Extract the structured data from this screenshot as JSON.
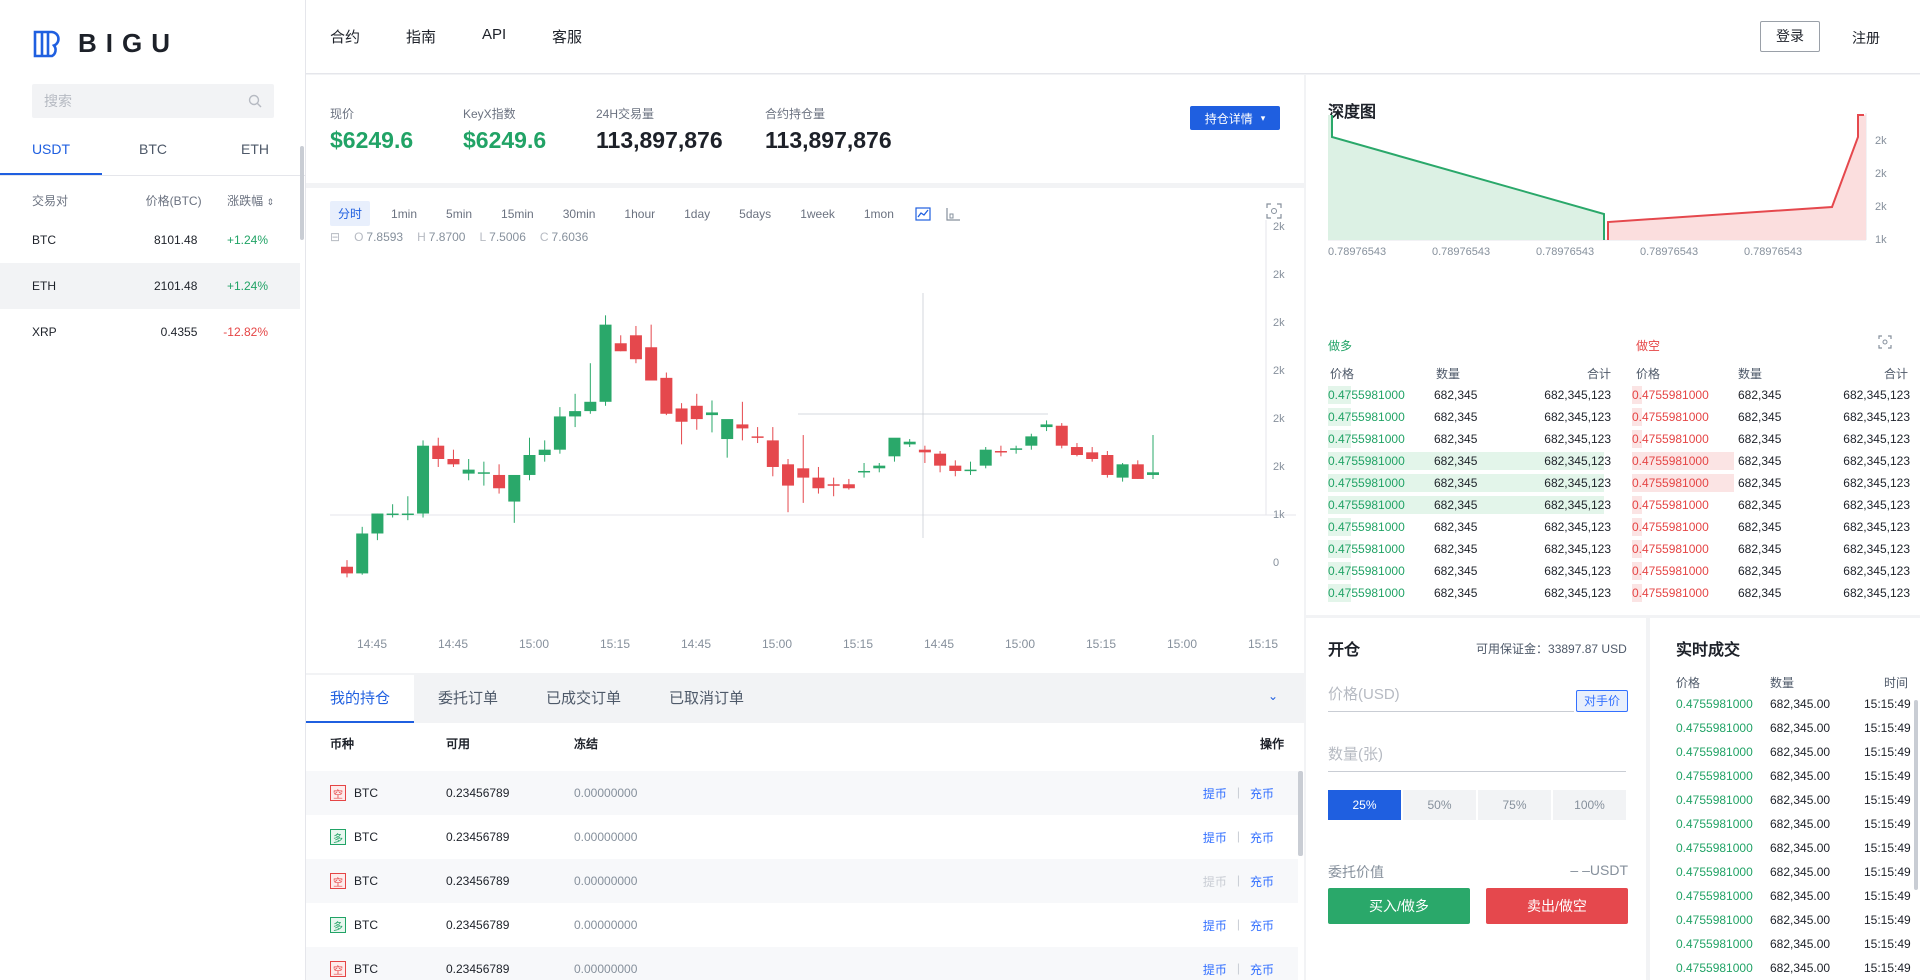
{
  "brand": {
    "name": "BIGU"
  },
  "sidebar": {
    "search_placeholder": "搜索",
    "tabs": [
      "USDT",
      "BTC",
      "ETH"
    ],
    "headers": {
      "pair": "交易对",
      "price": "价格(BTC)",
      "change": "涨跌幅"
    },
    "pairs": [
      {
        "name": "BTC",
        "price": "8101.48",
        "change": "+1.24%"
      },
      {
        "name": "ETH",
        "price": "2101.48",
        "change": "+1.24%"
      },
      {
        "name": "XRP",
        "price": "0.4355",
        "change": "-12.82%"
      }
    ]
  },
  "nav": {
    "items": [
      "合约",
      "指南",
      "API",
      "客服"
    ],
    "login": "登录",
    "register": "注册"
  },
  "stats": {
    "current": {
      "label": "现价",
      "value": "$6249.6"
    },
    "index": {
      "label": "KeyX指数",
      "value": "$6249.6"
    },
    "volume": {
      "label": "24H交易量",
      "value": "113,897,876"
    },
    "open_interest": {
      "label": "合约持仓量",
      "value": "113,897,876"
    },
    "detail_button": "持仓详情"
  },
  "chart": {
    "timeframes": [
      "分时",
      "1min",
      "5min",
      "15min",
      "30min",
      "1hour",
      "1day",
      "5days",
      "1week",
      "1mon"
    ],
    "ohlc": {
      "O": "7.8593",
      "H": "7.8700",
      "L": "7.5006",
      "C": "7.6036"
    },
    "y_ticks": [
      "2k",
      "2k",
      "2k",
      "2k",
      "2k",
      "2k",
      "1k",
      "0"
    ],
    "x_ticks": [
      "14:45",
      "14:45",
      "15:00",
      "15:15",
      "14:45",
      "15:00",
      "15:15",
      "14:45",
      "15:00",
      "15:15",
      "15:00",
      "15:15"
    ]
  },
  "chart_data": {
    "type": "candlestick",
    "candles": [
      {
        "o": 1.05,
        "h": 1.1,
        "l": 0.97,
        "c": 1.0
      },
      {
        "o": 1.0,
        "h": 1.35,
        "l": 0.99,
        "c": 1.3
      },
      {
        "o": 1.3,
        "h": 1.45,
        "l": 1.25,
        "c": 1.45
      },
      {
        "o": 1.45,
        "h": 1.52,
        "l": 1.42,
        "c": 1.45
      },
      {
        "o": 1.45,
        "h": 1.58,
        "l": 1.4,
        "c": 1.45
      },
      {
        "o": 1.45,
        "h": 2.0,
        "l": 1.42,
        "c": 1.96
      },
      {
        "o": 1.96,
        "h": 2.02,
        "l": 1.8,
        "c": 1.86
      },
      {
        "o": 1.86,
        "h": 1.93,
        "l": 1.8,
        "c": 1.82
      },
      {
        "o": 1.75,
        "h": 1.86,
        "l": 1.7,
        "c": 1.78
      },
      {
        "o": 1.76,
        "h": 1.84,
        "l": 1.66,
        "c": 1.76
      },
      {
        "o": 1.74,
        "h": 1.82,
        "l": 1.6,
        "c": 1.64
      },
      {
        "o": 1.54,
        "h": 1.72,
        "l": 1.38,
        "c": 1.74
      },
      {
        "o": 1.74,
        "h": 2.02,
        "l": 1.7,
        "c": 1.89
      },
      {
        "o": 1.89,
        "h": 2.0,
        "l": 1.84,
        "c": 1.93
      },
      {
        "o": 1.93,
        "h": 2.25,
        "l": 1.9,
        "c": 2.18
      },
      {
        "o": 2.18,
        "h": 2.35,
        "l": 2.1,
        "c": 2.22
      },
      {
        "o": 2.22,
        "h": 2.58,
        "l": 2.2,
        "c": 2.29
      },
      {
        "o": 2.29,
        "h": 2.94,
        "l": 2.26,
        "c": 2.87
      },
      {
        "o": 2.73,
        "h": 2.79,
        "l": 2.67,
        "c": 2.67
      },
      {
        "o": 2.79,
        "h": 2.86,
        "l": 2.58,
        "c": 2.61
      },
      {
        "o": 2.7,
        "h": 2.87,
        "l": 2.45,
        "c": 2.45
      },
      {
        "o": 2.47,
        "h": 2.51,
        "l": 2.19,
        "c": 2.2
      },
      {
        "o": 2.24,
        "h": 2.28,
        "l": 1.97,
        "c": 2.14
      },
      {
        "o": 2.26,
        "h": 2.35,
        "l": 2.08,
        "c": 2.16
      },
      {
        "o": 2.19,
        "h": 2.3,
        "l": 2.06,
        "c": 2.21
      },
      {
        "o": 2.01,
        "h": 2.05,
        "l": 1.87,
        "c": 2.16
      },
      {
        "o": 2.12,
        "h": 2.29,
        "l": 2.0,
        "c": 2.09
      },
      {
        "o": 2.03,
        "h": 2.1,
        "l": 1.98,
        "c": 2.02
      },
      {
        "o": 2.0,
        "h": 2.1,
        "l": 1.73,
        "c": 1.8
      },
      {
        "o": 1.82,
        "h": 1.86,
        "l": 1.46,
        "c": 1.66
      },
      {
        "o": 1.79,
        "h": 2.04,
        "l": 1.53,
        "c": 1.72
      },
      {
        "o": 1.72,
        "h": 1.8,
        "l": 1.6,
        "c": 1.64
      },
      {
        "o": 1.67,
        "h": 1.72,
        "l": 1.58,
        "c": 1.66
      },
      {
        "o": 1.67,
        "h": 1.71,
        "l": 1.63,
        "c": 1.64
      },
      {
        "o": 1.77,
        "h": 1.83,
        "l": 1.72,
        "c": 1.77
      },
      {
        "o": 1.79,
        "h": 1.83,
        "l": 1.76,
        "c": 1.81
      },
      {
        "o": 1.88,
        "h": 2.0,
        "l": 1.84,
        "c": 2.02
      },
      {
        "o": 1.97,
        "h": 2.01,
        "l": 1.95,
        "c": 1.99
      },
      {
        "o": 1.93,
        "h": 1.96,
        "l": 1.83,
        "c": 1.91
      },
      {
        "o": 1.9,
        "h": 1.92,
        "l": 1.76,
        "c": 1.81
      },
      {
        "o": 1.81,
        "h": 1.85,
        "l": 1.73,
        "c": 1.77
      },
      {
        "o": 1.77,
        "h": 1.84,
        "l": 1.74,
        "c": 1.78
      },
      {
        "o": 1.81,
        "h": 1.95,
        "l": 1.79,
        "c": 1.93
      },
      {
        "o": 1.92,
        "h": 1.96,
        "l": 1.88,
        "c": 1.91
      },
      {
        "o": 1.93,
        "h": 1.96,
        "l": 1.9,
        "c": 1.94
      },
      {
        "o": 1.96,
        "h": 2.05,
        "l": 1.93,
        "c": 2.03
      },
      {
        "o": 2.1,
        "h": 2.15,
        "l": 2.07,
        "c": 2.12
      },
      {
        "o": 2.11,
        "h": 2.13,
        "l": 1.94,
        "c": 1.96
      },
      {
        "o": 1.95,
        "h": 1.98,
        "l": 1.88,
        "c": 1.89
      },
      {
        "o": 1.91,
        "h": 1.95,
        "l": 1.84,
        "c": 1.86
      },
      {
        "o": 1.89,
        "h": 1.92,
        "l": 1.72,
        "c": 1.74
      },
      {
        "o": 1.72,
        "h": 1.83,
        "l": 1.69,
        "c": 1.82
      },
      {
        "o": 1.82,
        "h": 1.85,
        "l": 1.71,
        "c": 1.71
      },
      {
        "o": 1.74,
        "h": 2.04,
        "l": 1.71,
        "c": 1.76
      }
    ],
    "ylim": [
      0,
      3.0
    ]
  },
  "orders": {
    "tabs": [
      "我的持仓",
      "委托订单",
      "已成交订单",
      "已取消订单"
    ],
    "headers": [
      "币种",
      "可用",
      "冻结",
      "操作"
    ],
    "rows": [
      {
        "side": "空",
        "coin": "BTC",
        "available": "0.23456789",
        "frozen": "0.00000000",
        "withdraw": "提币",
        "deposit": "充币"
      },
      {
        "side": "多",
        "coin": "BTC",
        "available": "0.23456789",
        "frozen": "0.00000000",
        "withdraw": "提币",
        "deposit": "充币"
      },
      {
        "side": "空",
        "coin": "BTC",
        "available": "0.23456789",
        "frozen": "0.00000000",
        "withdraw": "提币",
        "deposit": "充币"
      },
      {
        "side": "多",
        "coin": "BTC",
        "available": "0.23456789",
        "frozen": "0.00000000",
        "withdraw": "提币",
        "deposit": "充币"
      },
      {
        "side": "空",
        "coin": "BTC",
        "available": "0.23456789",
        "frozen": "0.00000000",
        "withdraw": "提币",
        "deposit": "充币"
      }
    ]
  },
  "depth": {
    "title": "深度图",
    "x_ticks": [
      "0.78976543",
      "0.78976543",
      "0.78976543",
      "0.78976543",
      "0.78976543"
    ],
    "y_ticks": [
      "2k",
      "2k",
      "2k",
      "1k"
    ],
    "long_label": "做多",
    "short_label": "做空",
    "headers": [
      "价格",
      "数量",
      "合计"
    ],
    "row": {
      "price": "0.4755981000",
      "qty": "682,345",
      "total": "682,345,123"
    },
    "bid_fill": [
      0.08,
      0.08,
      0.08,
      0.95,
      0.95,
      0.95,
      0.08,
      0.08,
      0.08,
      0.08
    ],
    "ask_fill": [
      0.1,
      0.1,
      0.1,
      1.0,
      1.0,
      0.1,
      0.1,
      0.1,
      0.1,
      0.1
    ]
  },
  "open": {
    "title": "开仓",
    "margin_label": "可用保证金：",
    "margin_value": "33897.87 USD",
    "price_placeholder": "价格(USD)",
    "counter_price": "对手价",
    "qty_placeholder": "数量(张)",
    "pcts": [
      "25%",
      "50%",
      "75%",
      "100%"
    ],
    "value_label": "委托价值",
    "value": "– –USDT",
    "buy": "买入/做多",
    "sell": "卖出/做空"
  },
  "trades": {
    "title": "实时成交",
    "headers": [
      "价格",
      "数量",
      "时间"
    ],
    "row": {
      "price": "0.4755981000",
      "qty": "682,345.00",
      "time": "15:15:49"
    }
  },
  "colors": {
    "accent": "#1f5fe0",
    "up": "#21a366",
    "down": "#e54545"
  }
}
